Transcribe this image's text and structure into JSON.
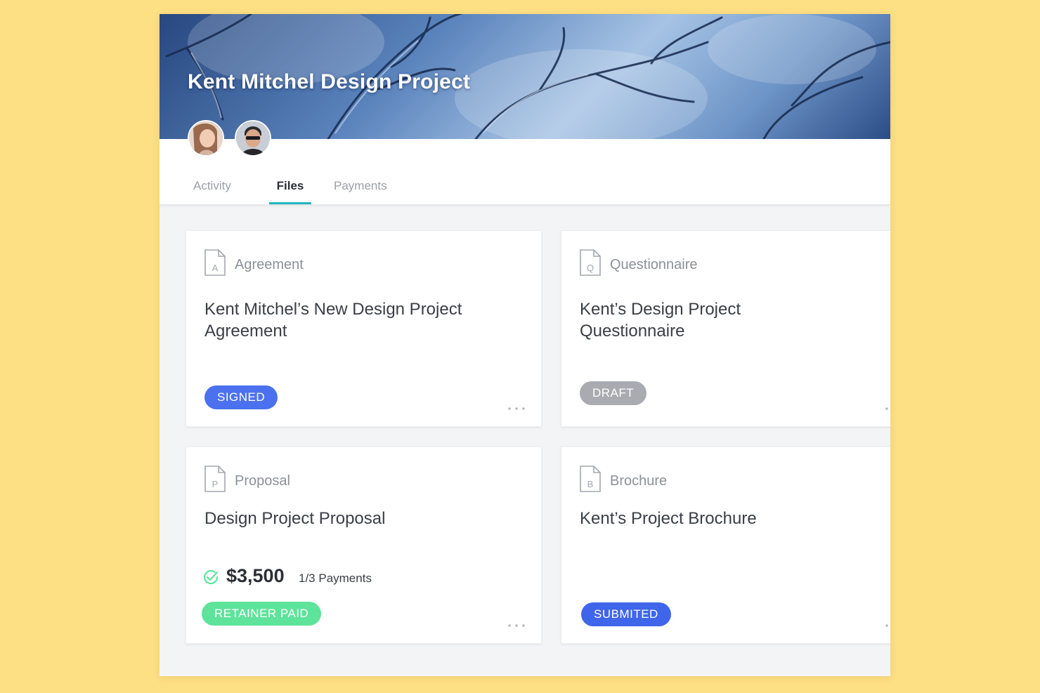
{
  "project": {
    "title": "Kent Mitchel Design Project"
  },
  "tabs": [
    {
      "label": "Activity"
    },
    {
      "label": "Files"
    },
    {
      "label": "Payments"
    }
  ],
  "cards": [
    {
      "type": "Agreement",
      "icon_letter": "A",
      "title": "Kent Mitchel’s New Design Project Agreement",
      "status": "SIGNED"
    },
    {
      "type": "Questionnaire",
      "icon_letter": "Q",
      "title": "Kent’s Design Project Questionnaire",
      "status": "DRAFT"
    },
    {
      "type": "Proposal",
      "icon_letter": "P",
      "title": "Design Project Proposal",
      "status": "RETAINER PAID",
      "amount": "$3,500",
      "payments": "1/3 Payments"
    },
    {
      "type": "Brochure",
      "icon_letter": "B",
      "title": "Kent’s Project Brochure",
      "status": "SUBMITED"
    }
  ],
  "colors": {
    "page_background": "#fddf84",
    "active_tab_underline": "#21b5bd",
    "signed": "#4b71ee",
    "draft": "#a9abb0",
    "retainer_paid": "#5ee39a",
    "submitted": "#3f66ea"
  },
  "icons": {
    "document": "document-icon",
    "more": "more-horizontal-icon",
    "check": "check-circle-icon"
  }
}
